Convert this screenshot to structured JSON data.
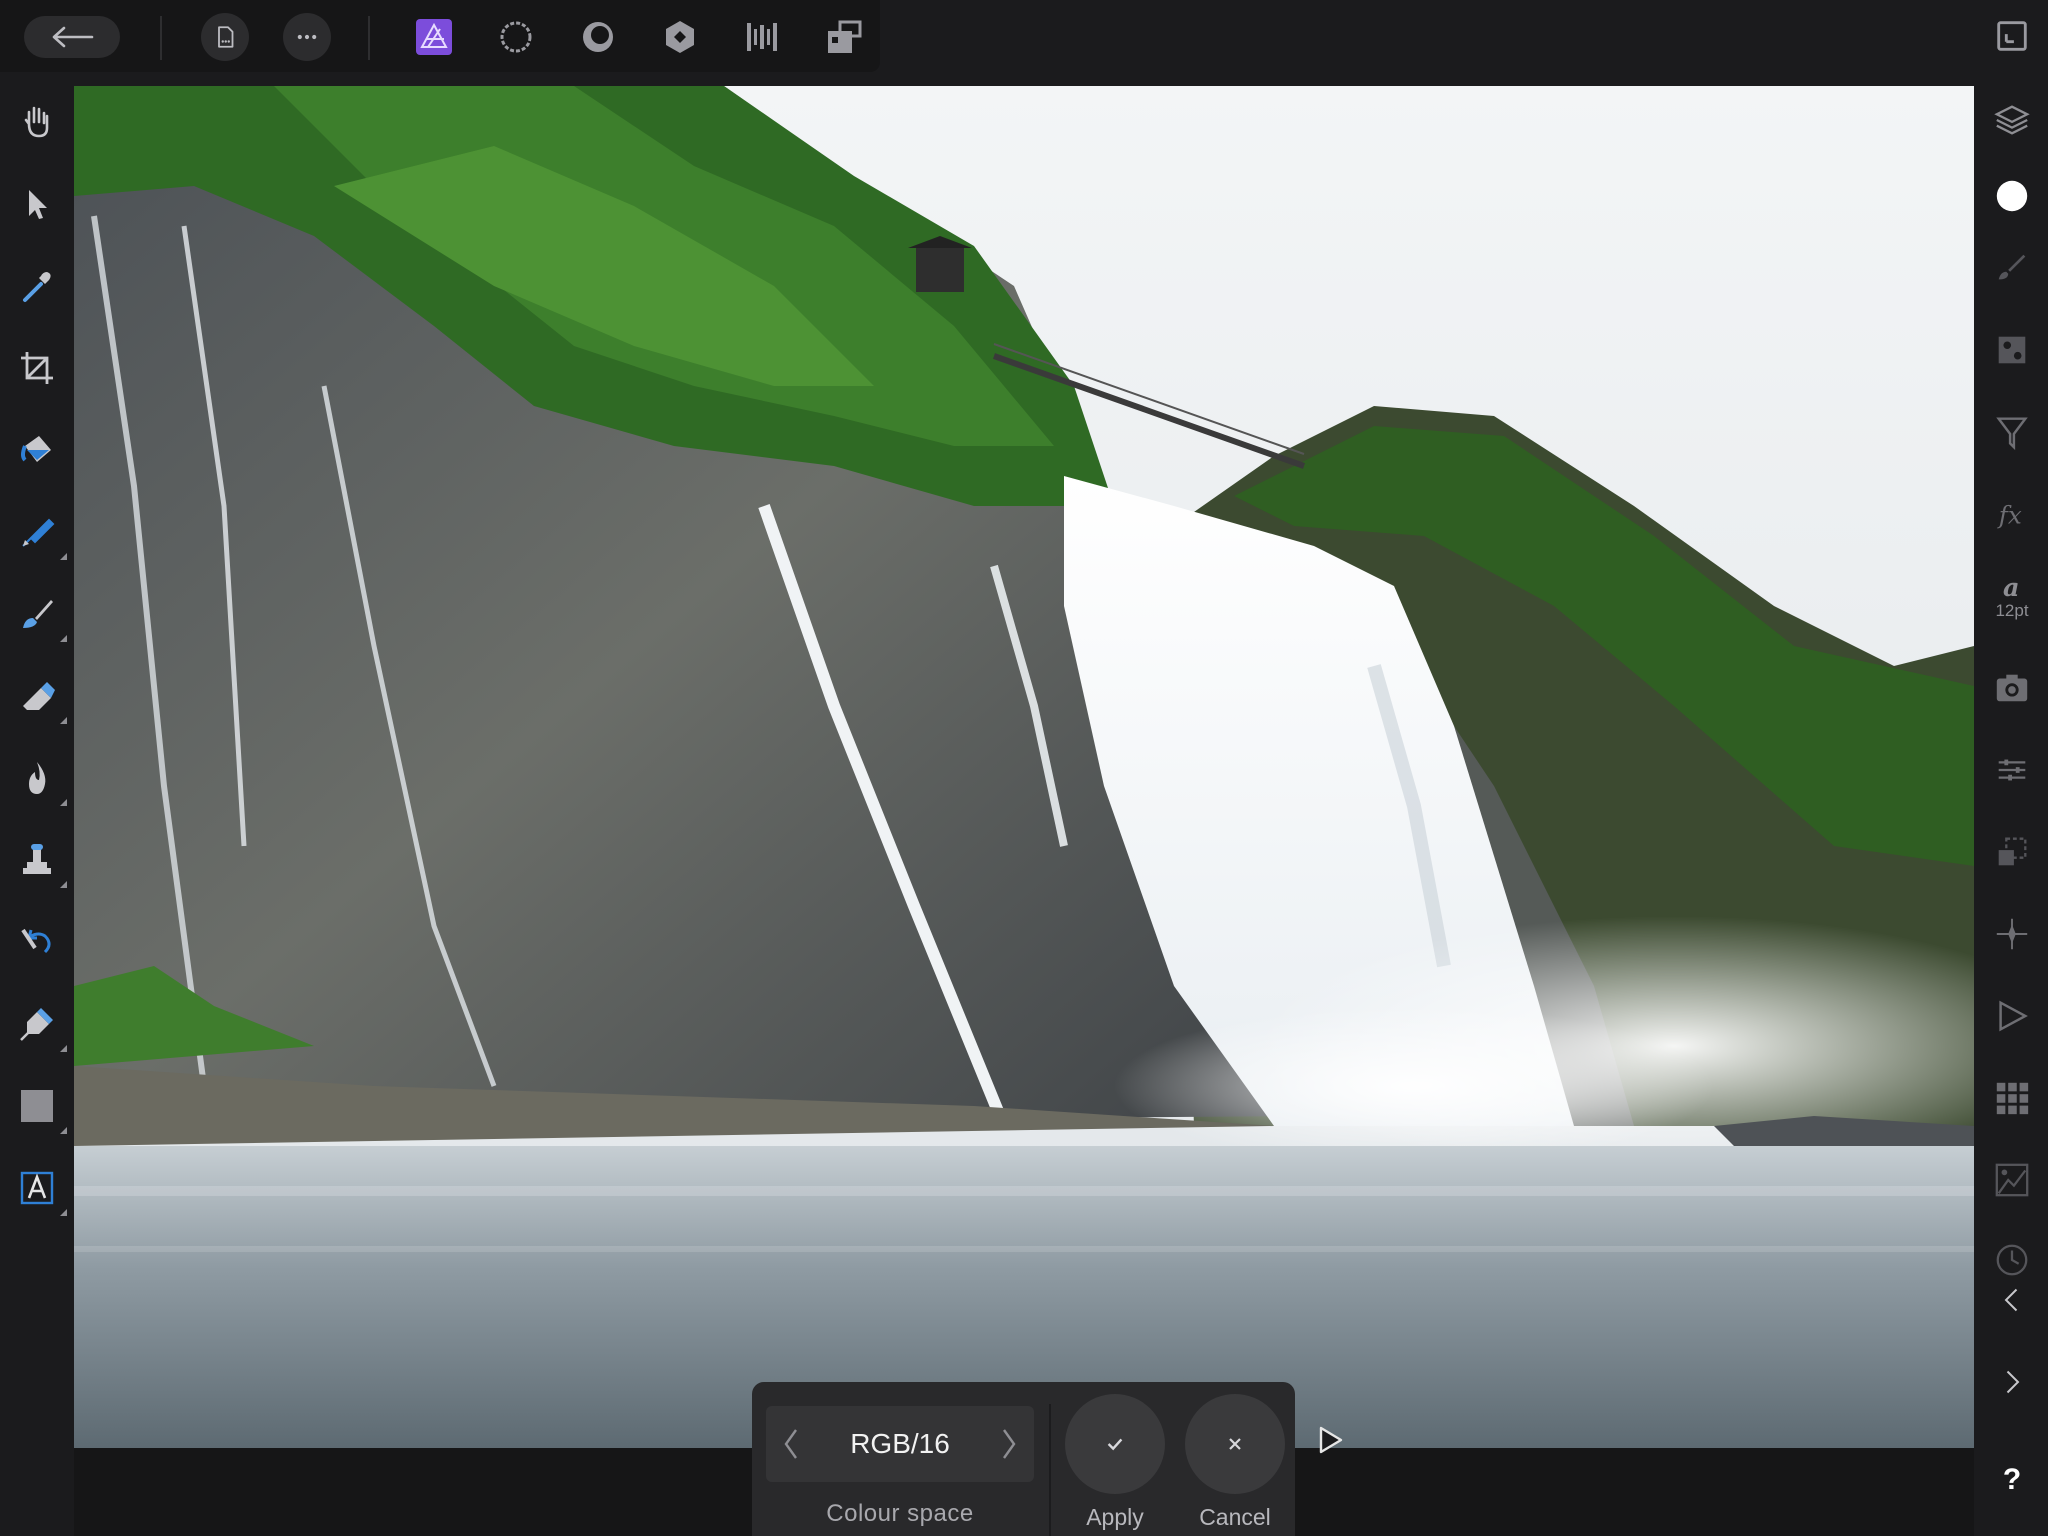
{
  "toolbar": {
    "back_icon": "back-arrow-icon",
    "document_icon": "document-icon",
    "more_icon": "more-icon",
    "personas": [
      "photo-persona-icon",
      "liquify-persona-icon",
      "develop-persona-icon",
      "tone-mapping-persona-icon",
      "export-persona-icon",
      "macro-persona-icon"
    ],
    "accent": "#8b5cf6"
  },
  "left_tools": [
    "hand-tool-icon",
    "move-tool-icon",
    "color-picker-icon",
    "crop-tool-icon",
    "flood-fill-icon",
    "selection-brush-icon",
    "paint-brush-icon",
    "erase-brush-icon",
    "burn-brush-icon",
    "clone-brush-icon",
    "undo-brush-icon",
    "pen-tool-icon",
    "rectangle-tool-icon",
    "artistic-text-icon"
  ],
  "right_studio": {
    "items": [
      "navigator-icon",
      "layers-icon",
      "color-icon",
      "brushes-icon",
      "adjustments-icon",
      "filters-icon",
      "fx-icon",
      "text-style-icon",
      "stock-icon",
      "transform-icon",
      "scope-icon",
      "snap-icon",
      "macro-icon",
      "channels-icon",
      "histogram-icon",
      "history-icon",
      "left-chevron-icon",
      "right-chevron-icon",
      "help-icon"
    ],
    "text_size_label": "12pt",
    "help_label": "?"
  },
  "context": {
    "colour_space_value": "RGB/16",
    "colour_space_label": "Colour space",
    "apply_label": "Apply",
    "cancel_label": "Cancel"
  }
}
